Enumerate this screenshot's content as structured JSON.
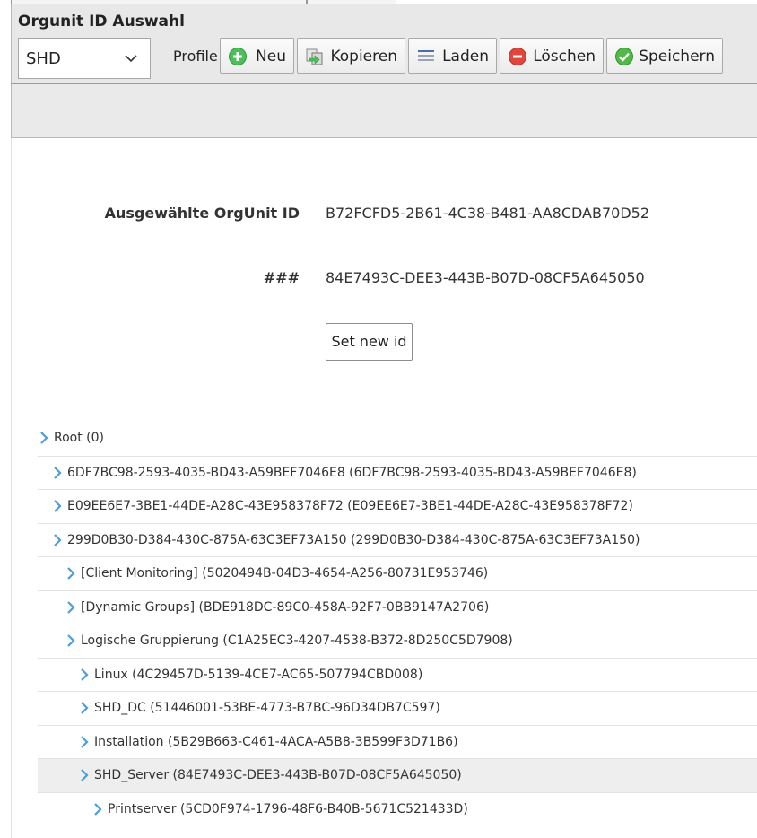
{
  "header": {
    "title": "Orgunit ID Auswahl",
    "select_value": "SHD",
    "profile_label": "Profile",
    "buttons": {
      "neu": "Neu",
      "kopieren": "Kopieren",
      "laden": "Laden",
      "loeschen": "Löschen",
      "speichern": "Speichern"
    }
  },
  "form": {
    "selected_label": "Ausgewählte OrgUnit ID",
    "selected_value": "B72FCFD5-2B61-4C38-B481-AA8CDAB70D52",
    "hash_label": "###",
    "hash_value": "84E7493C-DEE3-443B-B07D-08CF5A645050",
    "set_button": "Set new id"
  },
  "tree": [
    {
      "text": "Root (0)",
      "depth": 0,
      "selected": false
    },
    {
      "text": "6DF7BC98-2593-4035-BD43-A59BEF7046E8 (6DF7BC98-2593-4035-BD43-A59BEF7046E8)",
      "depth": 1,
      "selected": false
    },
    {
      "text": "E09EE6E7-3BE1-44DE-A28C-43E958378F72 (E09EE6E7-3BE1-44DE-A28C-43E958378F72)",
      "depth": 1,
      "selected": false
    },
    {
      "text": "299D0B30-D384-430C-875A-63C3EF73A150 (299D0B30-D384-430C-875A-63C3EF73A150)",
      "depth": 1,
      "selected": false
    },
    {
      "text": "[Client Monitoring] (5020494B-04D3-4654-A256-80731E953746)",
      "depth": 2,
      "selected": false
    },
    {
      "text": "[Dynamic Groups] (BDE918DC-89C0-458A-92F7-0BB9147A2706)",
      "depth": 2,
      "selected": false
    },
    {
      "text": "Logische Gruppierung (C1A25EC3-4207-4538-B372-8D250C5D7908)",
      "depth": 2,
      "selected": false
    },
    {
      "text": "Linux (4C29457D-5139-4CE7-AC65-507794CBD008)",
      "depth": 3,
      "selected": false
    },
    {
      "text": "SHD_DC (51446001-53BE-4773-B7BC-96D34DB7C597)",
      "depth": 3,
      "selected": false
    },
    {
      "text": "Installation (5B29B663-C461-4ACA-A5B8-3B599F3D71B6)",
      "depth": 3,
      "selected": false
    },
    {
      "text": "SHD_Server (84E7493C-DEE3-443B-B07D-08CF5A645050)",
      "depth": 3,
      "selected": true
    },
    {
      "text": "Printserver (5CD0F974-1796-48F6-B40B-5671C521433D)",
      "depth": 4,
      "selected": false
    }
  ],
  "colors": {
    "chevron": "#4a9fd8",
    "add": "#4bbf5a",
    "delete": "#e0463c",
    "save": "#52b84a"
  }
}
